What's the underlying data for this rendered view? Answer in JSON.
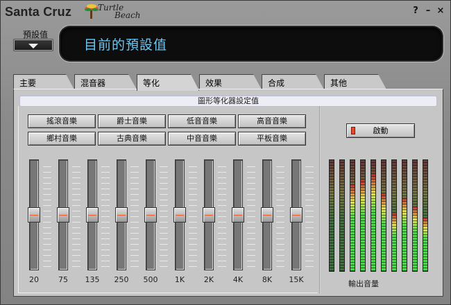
{
  "app": {
    "brand": "Santa Cruz",
    "logo_line1": "Turtle",
    "logo_line2": "Beach"
  },
  "window_controls": {
    "help": "?",
    "minimize": "–",
    "close": "×"
  },
  "preset": {
    "label": "預設值",
    "current": "目前的預設值"
  },
  "tabs": [
    "主要",
    "混音器",
    "等化",
    "效果",
    "合成",
    "其他"
  ],
  "active_tab": "等化",
  "section_title": "圖形等化器設定值",
  "presets": [
    "搖滾音樂",
    "爵士音樂",
    "低音音樂",
    "高音音樂",
    "鄉村音樂",
    "古典音樂",
    "中音音樂",
    "平板音樂"
  ],
  "bands": [
    {
      "label": "20",
      "level": 0.5
    },
    {
      "label": "75",
      "level": 0.5
    },
    {
      "label": "135",
      "level": 0.5
    },
    {
      "label": "250",
      "level": 0.5
    },
    {
      "label": "500",
      "level": 0.5
    },
    {
      "label": "1K",
      "level": 0.5
    },
    {
      "label": "2K",
      "level": 0.5
    },
    {
      "label": "4K",
      "level": 0.5
    },
    {
      "label": "8K",
      "level": 0.5
    },
    {
      "label": "15K",
      "level": 0.5
    }
  ],
  "start_button": "啟動",
  "meter_label": "輸出音量",
  "meters": [
    {
      "level": 0.0
    },
    {
      "level": 0.0
    },
    {
      "level": 0.78
    },
    {
      "level": 0.82
    },
    {
      "level": 0.87
    },
    {
      "level": 0.7
    },
    {
      "level": 0.52
    },
    {
      "level": 0.66
    },
    {
      "level": 0.58
    },
    {
      "level": 0.48
    }
  ],
  "colors": {
    "lcd_text": "#6fc6f2",
    "meter_green": "#3be63b",
    "meter_yellow": "#e8e83a",
    "meter_red": "#c82a2a",
    "knob_line": "#e85a2a"
  }
}
